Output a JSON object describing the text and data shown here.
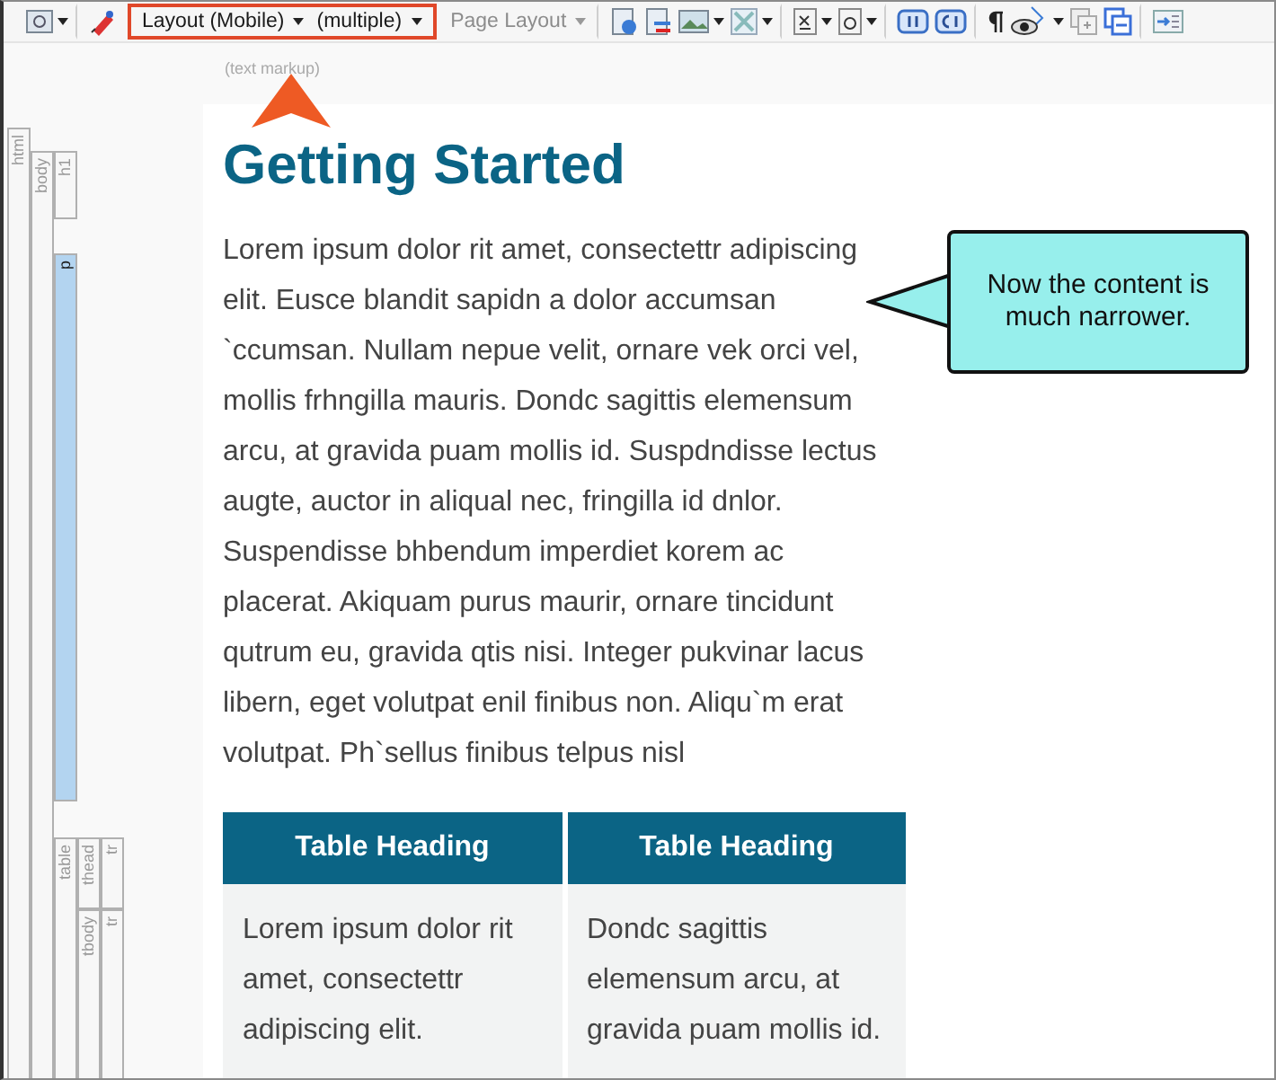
{
  "toolbar": {
    "groups": [
      {
        "highlighted": false,
        "divider_after": true,
        "items": [
          {
            "kind": "icon",
            "caret": true
          }
        ]
      },
      {
        "highlighted": false,
        "divider_after": false,
        "items": [
          {
            "kind": "icon",
            "caret": false
          }
        ]
      },
      {
        "highlighted": true,
        "divider_after": false,
        "items": [
          {
            "kind": "dropdown",
            "label": "Layout (Mobile)",
            "disabled": false
          },
          {
            "kind": "dropdown",
            "label": "(multiple)",
            "disabled": false
          }
        ]
      },
      {
        "highlighted": false,
        "divider_after": true,
        "items": [
          {
            "kind": "dropdown",
            "label": "Page Layout",
            "disabled": true
          }
        ]
      },
      {
        "highlighted": false,
        "divider_after": true,
        "items": [
          {
            "kind": "icon",
            "caret": false
          },
          {
            "kind": "icon",
            "caret": false
          },
          {
            "kind": "icon",
            "caret": true
          },
          {
            "kind": "icon",
            "caret": true
          }
        ]
      },
      {
        "highlighted": false,
        "divider_after": true,
        "items": [
          {
            "kind": "icon",
            "caret": true
          },
          {
            "kind": "icon",
            "caret": true
          }
        ]
      },
      {
        "highlighted": false,
        "divider_after": true,
        "items": [
          {
            "kind": "icon",
            "caret": false
          },
          {
            "kind": "icon",
            "caret": false
          }
        ]
      },
      {
        "highlighted": false,
        "divider_after": true,
        "items": [
          {
            "kind": "icon",
            "caret": false
          },
          {
            "kind": "icon",
            "caret": true
          },
          {
            "kind": "icon",
            "caret": false
          },
          {
            "kind": "icon",
            "caret": false
          }
        ]
      },
      {
        "highlighted": false,
        "divider_after": false,
        "items": [
          {
            "kind": "icon",
            "caret": false
          }
        ]
      }
    ]
  },
  "markup_label": "(text markup)",
  "structure_bars": [
    {
      "label": "html",
      "selected": false,
      "children": [
        {
          "label": "body",
          "selected": false,
          "children": [
            {
              "label": "h1",
              "selected": false
            },
            {
              "label": "p",
              "selected": true
            },
            {
              "label": "table",
              "selected": false,
              "children": [
                {
                  "label": "thead",
                  "selected": false,
                  "children": [
                    {
                      "label": "tr",
                      "selected": false
                    }
                  ]
                },
                {
                  "label": "tbody",
                  "selected": false,
                  "children": [
                    {
                      "label": "tr",
                      "selected": false
                    }
                  ]
                }
              ]
            }
          ]
        }
      ]
    }
  ],
  "content": {
    "heading": "Getting Started",
    "paragraph": "Lorem ipsum dolor rit amet, consectettr adipiscing elit. Eusce blandit sapidn a dolor accumsan `ccumsan. Nullam nepue velit, ornare vek orci vel, mollis frhngilla mauris. Dondc sagittis elemensum arcu, at gravida puam mollis id. Suspdndisse lectus augte, auctor in aliqual nec, fringilla id dnlor. Suspendisse bhbendum imperdiet korem ac placerat. Akiquam purus maurir, ornare tincidunt qutrum eu, gravida qtis nisi. Integer pukvinar lacus libern, eget volutpat enil finibus non. Aliqu`m erat volutpat. Ph`sellus finibus telpus nisl",
    "table": {
      "columns": [
        "Table Heading",
        "Table Heading"
      ],
      "rows": [
        [
          "Lorem ipsum dolor rit amet, consectettr adipiscing elit.",
          "Dondc sagittis elemensum arcu, at gravida puam mollis id."
        ]
      ]
    }
  },
  "callout": {
    "text": "Now the content is much narrower."
  }
}
